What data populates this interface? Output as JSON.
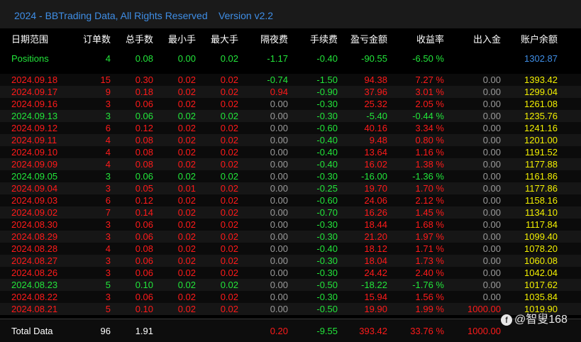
{
  "title": {
    "text": "2024 - BBTrading Data, All Rights Reserved",
    "version": "Version v2.2"
  },
  "headers": [
    "日期范围",
    "订单数",
    "总手数",
    "最小手",
    "最大手",
    "隔夜费",
    "手续费",
    "盈亏金额",
    "收益率",
    "出入金",
    "账户余额"
  ],
  "positions": {
    "label": "Positions",
    "orders": "4",
    "lots": "0.08",
    "min": "0.00",
    "max": "0.02",
    "swap": "-1.17",
    "fee": "-0.40",
    "pnl": "-90.55",
    "rate": "-6.50 %",
    "balance": "1302.87"
  },
  "rows": [
    {
      "date": "2024.09.18",
      "orders": "15",
      "lots": "0.30",
      "min": "0.02",
      "max": "0.02",
      "swap": "-0.74",
      "fee": "-1.50",
      "pnl": "94.38",
      "rate": "7.27 %",
      "io": "0.00",
      "balance": "1393.42",
      "c": "red",
      "sw": "green"
    },
    {
      "date": "2024.09.17",
      "orders": "9",
      "lots": "0.18",
      "min": "0.02",
      "max": "0.02",
      "swap": "0.94",
      "fee": "-0.90",
      "pnl": "37.96",
      "rate": "3.01 %",
      "io": "0.00",
      "balance": "1299.04",
      "c": "red",
      "sw": "red"
    },
    {
      "date": "2024.09.16",
      "orders": "3",
      "lots": "0.06",
      "min": "0.02",
      "max": "0.02",
      "swap": "0.00",
      "fee": "-0.30",
      "pnl": "25.32",
      "rate": "2.05 %",
      "io": "0.00",
      "balance": "1261.08",
      "c": "red",
      "sw": "gray"
    },
    {
      "date": "2024.09.13",
      "orders": "3",
      "lots": "0.06",
      "min": "0.02",
      "max": "0.02",
      "swap": "0.00",
      "fee": "-0.30",
      "pnl": "-5.40",
      "rate": "-0.44 %",
      "io": "0.00",
      "balance": "1235.76",
      "c": "green",
      "sw": "gray"
    },
    {
      "date": "2024.09.12",
      "orders": "6",
      "lots": "0.12",
      "min": "0.02",
      "max": "0.02",
      "swap": "0.00",
      "fee": "-0.60",
      "pnl": "40.16",
      "rate": "3.34 %",
      "io": "0.00",
      "balance": "1241.16",
      "c": "red",
      "sw": "gray"
    },
    {
      "date": "2024.09.11",
      "orders": "4",
      "lots": "0.08",
      "min": "0.02",
      "max": "0.02",
      "swap": "0.00",
      "fee": "-0.40",
      "pnl": "9.48",
      "rate": "0.80 %",
      "io": "0.00",
      "balance": "1201.00",
      "c": "red",
      "sw": "gray"
    },
    {
      "date": "2024.09.10",
      "orders": "4",
      "lots": "0.08",
      "min": "0.02",
      "max": "0.02",
      "swap": "0.00",
      "fee": "-0.40",
      "pnl": "13.64",
      "rate": "1.16 %",
      "io": "0.00",
      "balance": "1191.52",
      "c": "red",
      "sw": "gray"
    },
    {
      "date": "2024.09.09",
      "orders": "4",
      "lots": "0.08",
      "min": "0.02",
      "max": "0.02",
      "swap": "0.00",
      "fee": "-0.40",
      "pnl": "16.02",
      "rate": "1.38 %",
      "io": "0.00",
      "balance": "1177.88",
      "c": "red",
      "sw": "gray"
    },
    {
      "date": "2024.09.05",
      "orders": "3",
      "lots": "0.06",
      "min": "0.02",
      "max": "0.02",
      "swap": "0.00",
      "fee": "-0.30",
      "pnl": "-16.00",
      "rate": "-1.36 %",
      "io": "0.00",
      "balance": "1161.86",
      "c": "green",
      "sw": "gray"
    },
    {
      "date": "2024.09.04",
      "orders": "3",
      "lots": "0.05",
      "min": "0.01",
      "max": "0.02",
      "swap": "0.00",
      "fee": "-0.25",
      "pnl": "19.70",
      "rate": "1.70 %",
      "io": "0.00",
      "balance": "1177.86",
      "c": "red",
      "sw": "gray"
    },
    {
      "date": "2024.09.03",
      "orders": "6",
      "lots": "0.12",
      "min": "0.02",
      "max": "0.02",
      "swap": "0.00",
      "fee": "-0.60",
      "pnl": "24.06",
      "rate": "2.12 %",
      "io": "0.00",
      "balance": "1158.16",
      "c": "red",
      "sw": "gray"
    },
    {
      "date": "2024.09.02",
      "orders": "7",
      "lots": "0.14",
      "min": "0.02",
      "max": "0.02",
      "swap": "0.00",
      "fee": "-0.70",
      "pnl": "16.26",
      "rate": "1.45 %",
      "io": "0.00",
      "balance": "1134.10",
      "c": "red",
      "sw": "gray"
    },
    {
      "date": "2024.08.30",
      "orders": "3",
      "lots": "0.06",
      "min": "0.02",
      "max": "0.02",
      "swap": "0.00",
      "fee": "-0.30",
      "pnl": "18.44",
      "rate": "1.68 %",
      "io": "0.00",
      "balance": "1117.84",
      "c": "red",
      "sw": "gray"
    },
    {
      "date": "2024.08.29",
      "orders": "3",
      "lots": "0.06",
      "min": "0.02",
      "max": "0.02",
      "swap": "0.00",
      "fee": "-0.30",
      "pnl": "21.20",
      "rate": "1.97 %",
      "io": "0.00",
      "balance": "1099.40",
      "c": "red",
      "sw": "gray"
    },
    {
      "date": "2024.08.28",
      "orders": "4",
      "lots": "0.08",
      "min": "0.02",
      "max": "0.02",
      "swap": "0.00",
      "fee": "-0.40",
      "pnl": "18.12",
      "rate": "1.71 %",
      "io": "0.00",
      "balance": "1078.20",
      "c": "red",
      "sw": "gray"
    },
    {
      "date": "2024.08.27",
      "orders": "3",
      "lots": "0.06",
      "min": "0.02",
      "max": "0.02",
      "swap": "0.00",
      "fee": "-0.30",
      "pnl": "18.04",
      "rate": "1.73 %",
      "io": "0.00",
      "balance": "1060.08",
      "c": "red",
      "sw": "gray"
    },
    {
      "date": "2024.08.26",
      "orders": "3",
      "lots": "0.06",
      "min": "0.02",
      "max": "0.02",
      "swap": "0.00",
      "fee": "-0.30",
      "pnl": "24.42",
      "rate": "2.40 %",
      "io": "0.00",
      "balance": "1042.04",
      "c": "red",
      "sw": "gray"
    },
    {
      "date": "2024.08.23",
      "orders": "5",
      "lots": "0.10",
      "min": "0.02",
      "max": "0.02",
      "swap": "0.00",
      "fee": "-0.50",
      "pnl": "-18.22",
      "rate": "-1.76 %",
      "io": "0.00",
      "balance": "1017.62",
      "c": "green",
      "sw": "gray"
    },
    {
      "date": "2024.08.22",
      "orders": "3",
      "lots": "0.06",
      "min": "0.02",
      "max": "0.02",
      "swap": "0.00",
      "fee": "-0.30",
      "pnl": "15.94",
      "rate": "1.56 %",
      "io": "0.00",
      "balance": "1035.84",
      "c": "red",
      "sw": "gray"
    },
    {
      "date": "2024.08.21",
      "orders": "5",
      "lots": "0.10",
      "min": "0.02",
      "max": "0.02",
      "swap": "0.00",
      "fee": "-0.50",
      "pnl": "19.90",
      "rate": "1.99 %",
      "io": "1000.00",
      "balance": "1019.90",
      "c": "red",
      "sw": "gray",
      "ioc": "red"
    }
  ],
  "total": {
    "label": "Total Data",
    "orders": "96",
    "lots": "1.91",
    "swap": "0.20",
    "fee": "-9.55",
    "pnl": "393.42",
    "rate": "33.76 %",
    "io": "1000.00"
  },
  "watermark": "@智叟168",
  "colors": {
    "red": "#ff1a1a",
    "green": "#22e53a",
    "yellow": "#f3f000",
    "blue": "#3f8ee6",
    "gray": "#9a9a9a"
  }
}
